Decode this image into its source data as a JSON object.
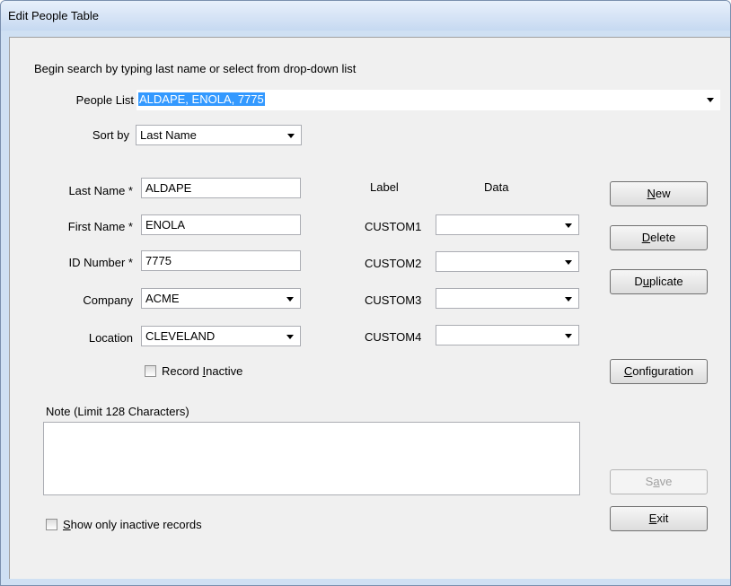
{
  "window": {
    "title": "Edit People Table"
  },
  "instruction": "Begin search by typing last name or select from drop-down list",
  "people_list": {
    "label": "People List",
    "value": "ALDAPE, ENOLA, 7775"
  },
  "sort_by": {
    "label": "Sort by",
    "value": "Last Name"
  },
  "fields": {
    "last_name": {
      "label": "Last Name *",
      "value": "ALDAPE"
    },
    "first_name": {
      "label": "First Name *",
      "value": "ENOLA"
    },
    "id_number": {
      "label": "ID Number *",
      "value": "7775"
    },
    "company": {
      "label": "Company",
      "value": "ACME"
    },
    "location": {
      "label": "Location",
      "value": "CLEVELAND"
    }
  },
  "record_inactive": {
    "label_pre": "Record ",
    "label_mnemonic": "I",
    "label_post": "nactive",
    "checked": false
  },
  "custom": {
    "label_header": "Label",
    "data_header": "Data",
    "rows": [
      {
        "label": "CUSTOM1",
        "value": ""
      },
      {
        "label": "CUSTOM2",
        "value": ""
      },
      {
        "label": "CUSTOM3",
        "value": ""
      },
      {
        "label": "CUSTOM4",
        "value": ""
      }
    ]
  },
  "note": {
    "label": "Note (Limit 128 Characters)",
    "value": ""
  },
  "show_inactive": {
    "label_mnemonic": "S",
    "label_post": "how only inactive records",
    "checked": false
  },
  "buttons": {
    "new": {
      "mnemonic": "N",
      "rest": "ew"
    },
    "delete": {
      "mnemonic": "D",
      "rest": "elete"
    },
    "duplicate": {
      "pre": "D",
      "mnemonic": "u",
      "rest": "plicate"
    },
    "configuration": {
      "mnemonic": "C",
      "rest": "onfiguration"
    },
    "save": {
      "pre": "S",
      "mnemonic": "a",
      "rest": "ve",
      "enabled": false
    },
    "exit": {
      "mnemonic": "E",
      "rest": "xit"
    }
  }
}
